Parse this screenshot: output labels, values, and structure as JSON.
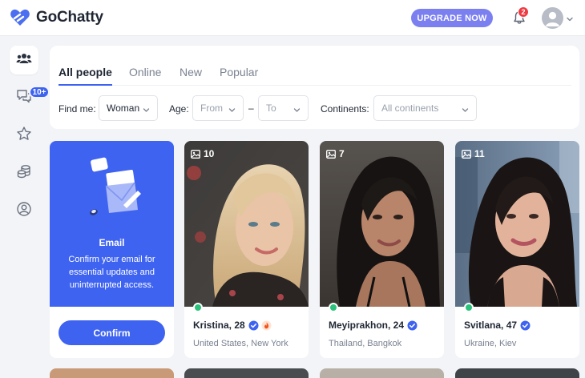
{
  "header": {
    "brand": "GoChatty",
    "upgrade_label": "UPGRADE NOW",
    "notification_count": "2"
  },
  "sidebar": {
    "items": [
      {
        "icon": "people-icon",
        "active": true
      },
      {
        "icon": "chat-icon",
        "badge": "10+"
      },
      {
        "icon": "star-icon"
      },
      {
        "icon": "coins-icon"
      },
      {
        "icon": "profile-icon"
      }
    ]
  },
  "filters": {
    "tabs": [
      "All people",
      "Online",
      "New",
      "Popular"
    ],
    "active_tab": "All people",
    "find_me_label": "Find me:",
    "find_me_value": "Woman",
    "age_label": "Age:",
    "age_from_placeholder": "From",
    "age_separator": "–",
    "age_to_placeholder": "To",
    "continents_label": "Continents:",
    "continents_placeholder": "All continents"
  },
  "email_card": {
    "title": "Email",
    "text": "Confirm your email for essential updates and uninterrupted access.",
    "button": "Confirm"
  },
  "profiles": [
    {
      "photos": "10",
      "name": "Kristina, 28",
      "verified": true,
      "hot": true,
      "location": "United States, New York",
      "online": true
    },
    {
      "photos": "7",
      "name": "Meyiprakhon, 24",
      "verified": true,
      "hot": false,
      "location": "Thailand, Bangkok",
      "online": true
    },
    {
      "photos": "11",
      "name": "Svitlana, 47",
      "verified": true,
      "hot": false,
      "location": "Ukraine, Kiev",
      "online": true
    }
  ],
  "colors": {
    "accent": "#3e63f0",
    "upgrade": "#7b7ff0",
    "online": "#2bc27b",
    "badge": "#ef3b43"
  }
}
